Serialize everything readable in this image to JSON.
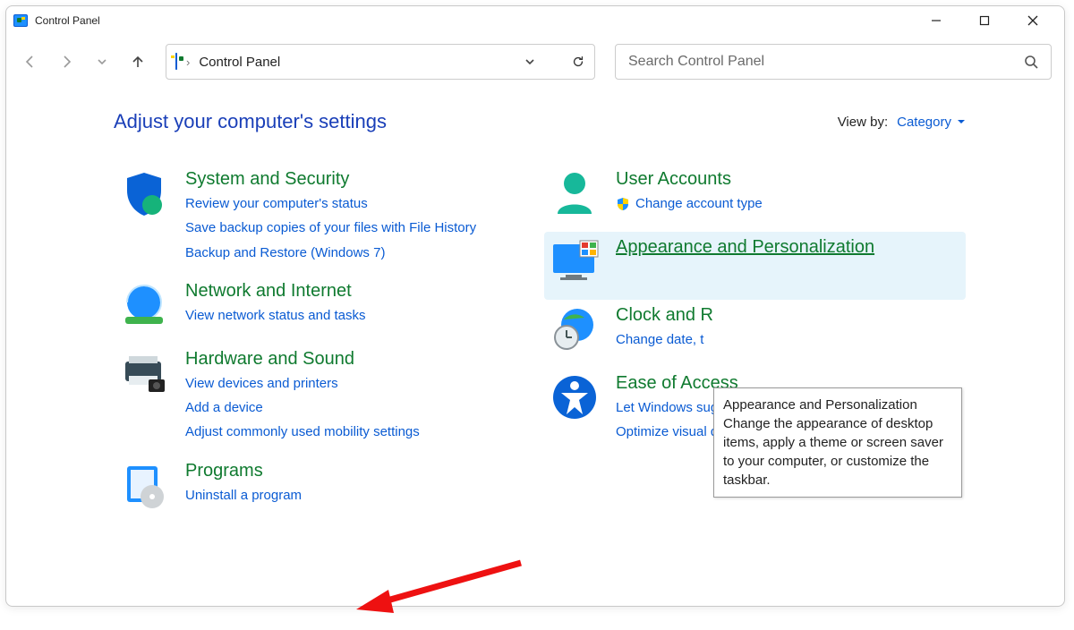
{
  "window": {
    "title": "Control Panel"
  },
  "toolbar": {
    "breadcrumb": "Control Panel",
    "search_placeholder": "Search Control Panel"
  },
  "heading": "Adjust your computer's settings",
  "viewby": {
    "label": "View by:",
    "value": "Category"
  },
  "left_column": [
    {
      "name": "system-security",
      "title": "System and Security",
      "links": [
        "Review your computer's status",
        "Save backup copies of your files with File History",
        "Backup and Restore (Windows 7)"
      ]
    },
    {
      "name": "network-internet",
      "title": "Network and Internet",
      "links": [
        "View network status and tasks"
      ]
    },
    {
      "name": "hardware-sound",
      "title": "Hardware and Sound",
      "links": [
        "View devices and printers",
        "Add a device",
        "Adjust commonly used mobility settings"
      ]
    },
    {
      "name": "programs",
      "title": "Programs",
      "links": [
        "Uninstall a program"
      ]
    }
  ],
  "right_column": [
    {
      "name": "user-accounts",
      "title": "User Accounts",
      "links": [
        "Change account type"
      ],
      "link_has_shield": true
    },
    {
      "name": "appearance",
      "title": "Appearance and Personalization",
      "links": [],
      "highlight": true
    },
    {
      "name": "clock-region",
      "title": "Clock and Region",
      "title_truncated": "Clock and R",
      "links": [
        "Change date, time, or number formats"
      ],
      "link_truncated": "Change date, t"
    },
    {
      "name": "ease-of-access",
      "title": "Ease of Access",
      "links": [
        "Let Windows suggest settings",
        "Optimize visual display"
      ]
    }
  ],
  "tooltip": {
    "title": "Appearance and Personalization",
    "body": "Change the appearance of desktop items, apply a theme or screen saver to your computer, or customize the taskbar."
  }
}
